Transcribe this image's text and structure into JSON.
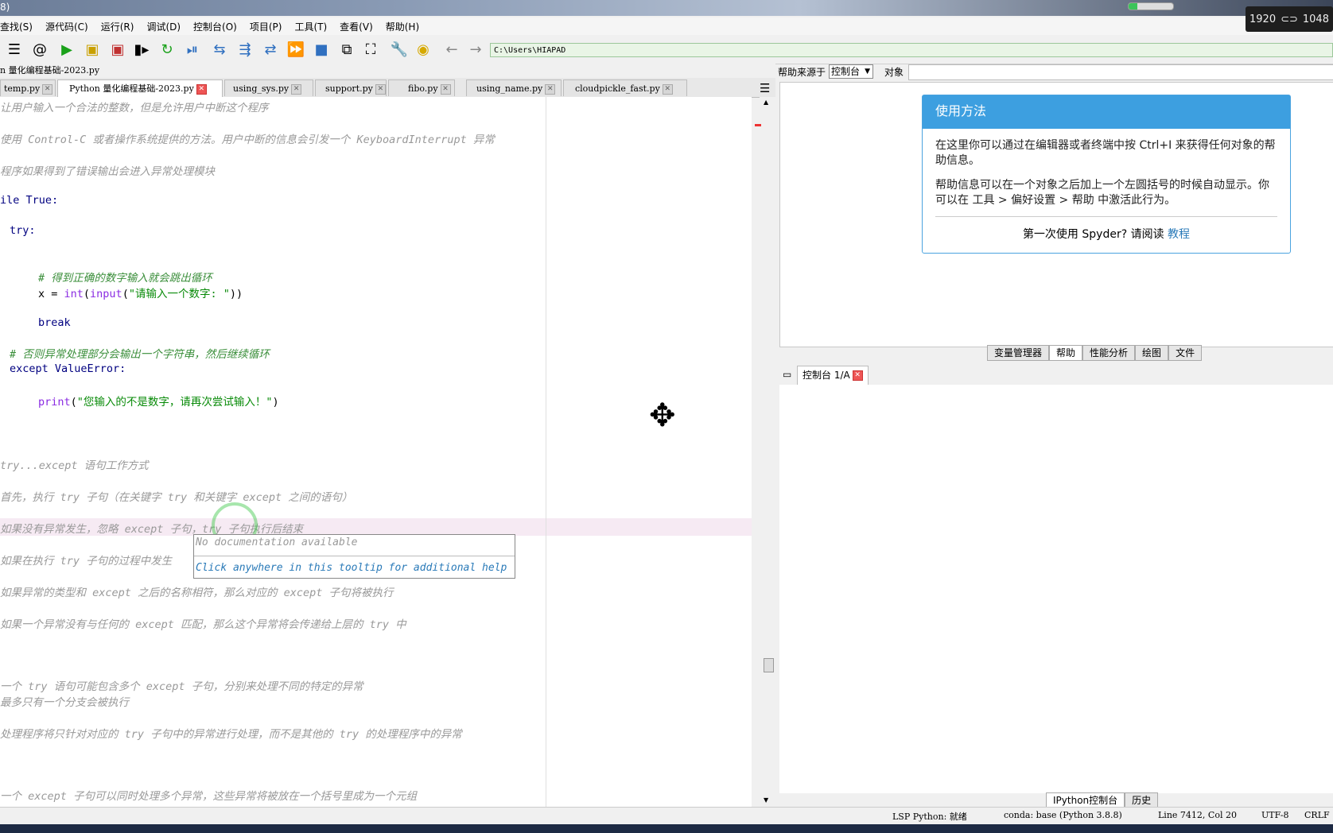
{
  "window": {
    "title_fragment": "8)",
    "resolution_w": "1920",
    "resolution_h": "1048"
  },
  "menu": [
    "查找(S)",
    "源代码(C)",
    "运行(R)",
    "调试(D)",
    "控制台(O)",
    "项目(P)",
    "工具(T)",
    "查看(V)",
    "帮助(H)"
  ],
  "toolbar": {
    "path": "C:\\Users\\HIAPAD"
  },
  "editor": {
    "file_title": "n 量化编程基础-2023.py",
    "tabs": [
      {
        "label": "temp.py",
        "active": false
      },
      {
        "label": "Python 量化编程基础-2023.py",
        "active": true
      },
      {
        "label": "using_sys.py",
        "active": false
      },
      {
        "label": "support.py",
        "active": false
      },
      {
        "label": "fibo.py",
        "active": false
      },
      {
        "label": "using_name.py",
        "active": false
      },
      {
        "label": "cloudpickle_fast.py",
        "active": false
      }
    ],
    "lines": {
      "l1": "让用户输入一个合法的整数，但是允许用户中断这个程序",
      "l2": "使用 Control-C 或者操作系统提供的方法。用户中断的信息会引发一个 KeyboardInterrupt 异常",
      "l3": "程序如果得到了错误输出会进入异常处理模块",
      "l4_kw": "ile True:",
      "l5_kw": "try:",
      "l6_cmt": "# 得到正确的数字输入就会跳出循环",
      "l7_a": "x = ",
      "l7_b": "int",
      "l7_c": "(",
      "l7_d": "input",
      "l7_e": "(",
      "l7_f": "\"请输入一个数字: \"",
      "l7_g": "))",
      "l8_kw": "break",
      "l9_cmt": "# 否则异常处理部分会输出一个字符串，然后继续循环",
      "l10_kw": "except ValueError:",
      "l11_a": "print",
      "l11_b": "(",
      "l11_c": "\"您输入的不是数字，请再次尝试输入！\"",
      "l11_d": ")",
      "l12": "try...except 语句工作方式",
      "l13": "首先，执行 try 子句（在关键字 try 和关键字 except 之间的语句）",
      "l14": "如果没有异常发生，忽略 except 子句，try 子句执行后结束",
      "l15": "如果在执行 try 子句的过程中发生",
      "l16": "如果异常的类型和 except 之后的名称相符，那么对应的 except 子句将被执行",
      "l17": "如果一个异常没有与任何的 except 匹配，那么这个异常将会传递给上层的 try 中",
      "l18": "一个 try 语句可能包含多个 except 子句，分别来处理不同的特定的异常",
      "l19": "最多只有一个分支会被执行",
      "l20": "处理程序将只针对对应的 try 子句中的异常进行处理，而不是其他的 try 的处理程序中的异常",
      "l21": "一个 except 子句可以同时处理多个异常，这些异常将被放在一个括号里成为一个元组"
    },
    "tooltip": {
      "line1": "No documentation available",
      "line2": "Click anywhere in this tooltip for additional help"
    }
  },
  "help": {
    "source_label": "帮助来源于",
    "source_value": "控制台",
    "object_label": "对象",
    "card": {
      "title": "使用方法",
      "p1": "在这里你可以通过在编辑器或者终端中按 Ctrl+I 来获得任何对象的帮助信息。",
      "p2": "帮助信息可以在一个对象之后加上一个左圆括号的时候自动显示。你可以在 工具 > 偏好设置 > 帮助 中激活此行为。",
      "footer_text": "第一次使用 Spyder? 请阅读",
      "footer_link": "教程"
    },
    "pane_tabs": [
      "变量管理器",
      "帮助",
      "性能分析",
      "绘图",
      "文件"
    ],
    "active_pane_tab": "帮助"
  },
  "console": {
    "tab_label": "控制台 1/A",
    "bottom_tabs": [
      "IPython控制台",
      "历史"
    ]
  },
  "status": {
    "lsp": "LSP Python: 就绪",
    "conda": "conda: base (Python 3.8.8)",
    "position": "Line 7412, Col 20",
    "encoding": "UTF-8",
    "eol": "CRLF"
  },
  "colors": {
    "accent": "#3d9fe0",
    "path_bg": "#e9f5e6",
    "tab_close": "#e55555"
  }
}
